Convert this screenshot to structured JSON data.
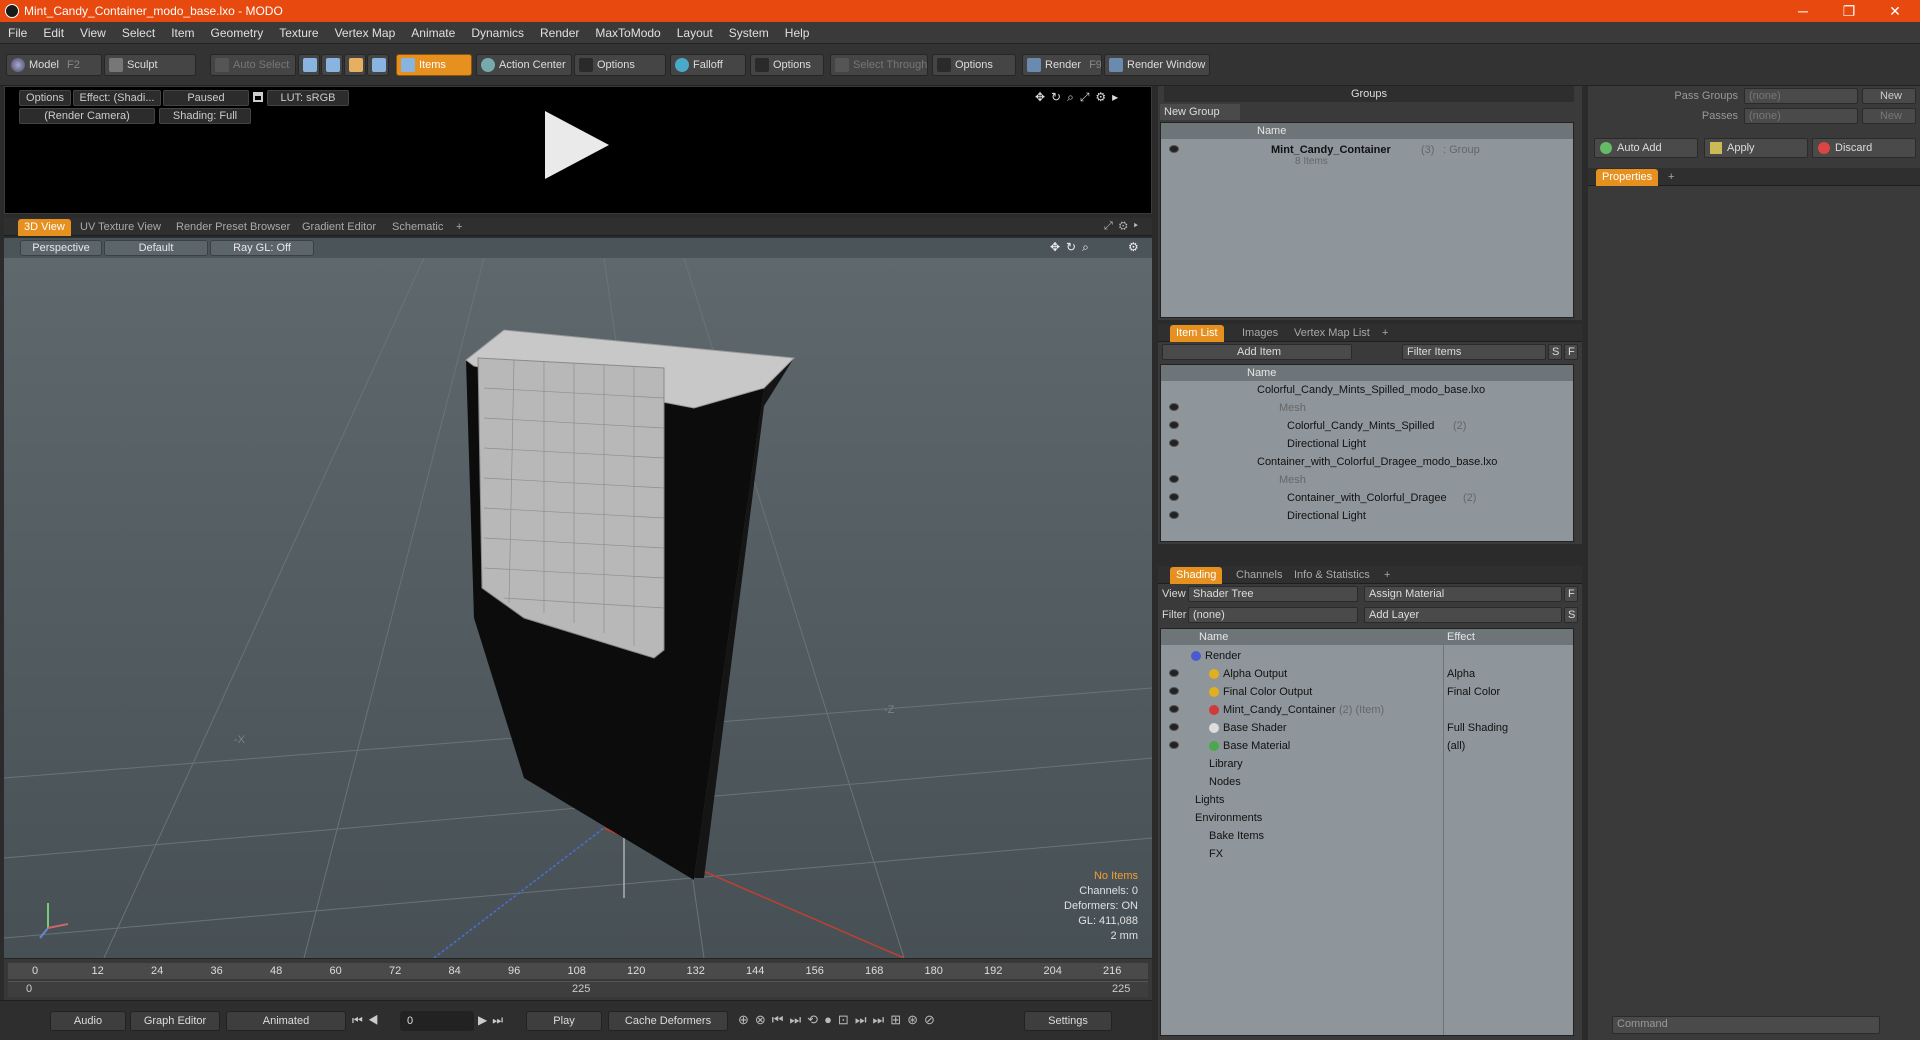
{
  "window": {
    "title": "Mint_Candy_Container_modo_base.lxo - MODO",
    "minimize": "─",
    "maximize": "❐",
    "close": "✕"
  },
  "menu": [
    "File",
    "Edit",
    "View",
    "Select",
    "Item",
    "Geometry",
    "Texture",
    "Vertex Map",
    "Animate",
    "Dynamics",
    "Render",
    "MaxToModo",
    "Layout",
    "System",
    "Help"
  ],
  "toolbar": {
    "model": "Model",
    "model_key": "F2",
    "sculpt": "Sculpt",
    "auto_select": "Auto Select",
    "items": "Items",
    "action_center": "Action Center",
    "options1": "Options",
    "falloff": "Falloff",
    "options2": "Options",
    "select_through": "Select Through",
    "options3": "Options",
    "render": "Render",
    "render_key": "F9",
    "render_window": "Render Window"
  },
  "preview": {
    "options": "Options",
    "effect": "Effect: (Shadi...",
    "paused": "Paused",
    "lut": "LUT: sRGB",
    "camera": "(Render Camera)",
    "shading": "Shading: Full"
  },
  "viewtabs": [
    "3D View",
    "UV Texture View",
    "Render Preset Browser",
    "Gradient Editor",
    "Schematic",
    "+"
  ],
  "viewport": {
    "perspective": "Perspective",
    "default": "Default",
    "raygl": "Ray GL: Off",
    "axis_x": "-X",
    "axis_z": "-Z",
    "stats": {
      "items": "No Items",
      "channels": "Channels: 0",
      "deformers": "Deformers: ON",
      "gl": "GL: 411,088",
      "unit": "2 mm"
    }
  },
  "timeline": {
    "ticks": [
      "0",
      "12",
      "24",
      "36",
      "48",
      "60",
      "72",
      "84",
      "96",
      "108",
      "120",
      "132",
      "144",
      "156",
      "168",
      "180",
      "192",
      "204",
      "216"
    ],
    "start": "0",
    "mid": "225",
    "end": "225"
  },
  "bottombar": {
    "audio": "Audio",
    "graph_editor": "Graph Editor",
    "animated": "Animated",
    "frame": "0",
    "play": "Play",
    "cache": "Cache Deformers",
    "settings": "Settings"
  },
  "groups": {
    "title": "Groups",
    "new_group": "New Group",
    "col_name": "Name",
    "item_name": "Mint_Candy_Container",
    "item_count": "(3)",
    "item_type": ": Group",
    "item_sub": "8 Items"
  },
  "itemlist": {
    "tabs": [
      "Item List",
      "Images",
      "Vertex Map List",
      "+"
    ],
    "add_item": "Add Item",
    "filter": "Filter Items",
    "s": "S",
    "f": "F",
    "col_name": "Name",
    "rows": [
      {
        "label": "Colorful_Candy_Mints_Spilled_modo_base.lxo",
        "muted": false
      },
      {
        "label": "Mesh",
        "muted": true
      },
      {
        "label": "Colorful_Candy_Mints_Spilled",
        "count": "(2)",
        "muted": false
      },
      {
        "label": "Directional Light",
        "muted": false
      },
      {
        "label": "Container_with_Colorful_Dragee_modo_base.lxo",
        "muted": false
      },
      {
        "label": "Mesh",
        "muted": true
      },
      {
        "label": "Container_with_Colorful_Dragee",
        "count": "(2)",
        "muted": false
      },
      {
        "label": "Directional Light",
        "muted": false
      }
    ]
  },
  "shading": {
    "tabs": [
      "Shading",
      "Channels",
      "Info & Statistics",
      "+"
    ],
    "view_label": "View",
    "view_value": "Shader Tree",
    "assign": "Assign Material",
    "f": "F",
    "filter_label": "Filter",
    "filter_value": "(none)",
    "add_layer": "Add Layer",
    "s": "S",
    "col_name": "Name",
    "col_effect": "Effect",
    "rows": [
      {
        "name": "Render",
        "effect": ""
      },
      {
        "name": "Alpha Output",
        "effect": "Alpha"
      },
      {
        "name": "Final Color Output",
        "effect": "Final Color"
      },
      {
        "name": "Mint_Candy_Container",
        "extra": "(2) (Item)",
        "effect": ""
      },
      {
        "name": "Base Shader",
        "effect": "Full Shading"
      },
      {
        "name": "Base Material",
        "effect": "(all)"
      },
      {
        "name": "Library",
        "effect": ""
      },
      {
        "name": "Nodes",
        "effect": ""
      },
      {
        "name": "Lights",
        "effect": ""
      },
      {
        "name": "Environments",
        "effect": ""
      },
      {
        "name": "Bake Items",
        "effect": ""
      },
      {
        "name": "FX",
        "effect": ""
      }
    ]
  },
  "right": {
    "pass_groups": "Pass Groups",
    "passes": "Passes",
    "none1": "(none)",
    "none2": "(none)",
    "new1": "New",
    "new2": "New",
    "auto_add": "Auto Add",
    "apply": "Apply",
    "discard": "Discard",
    "properties": "Properties",
    "plus": "+",
    "command": "Command"
  }
}
